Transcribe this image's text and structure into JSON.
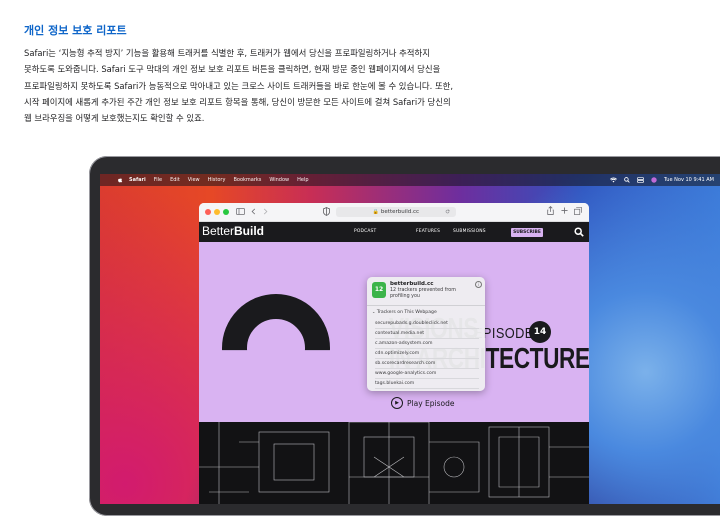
{
  "heading": "개인 정보 보호 리포트",
  "paragraph": [
    "Safari는 ‘지능형 추적 방지’ 기능을 활용해 트래커를 식별한 후, 트래커가 웹에서 당신을 프로파일링하거나 추적하지",
    "못하도록 도와줍니다. Safari 도구 막대의 개인 정보 보호 리포트 버튼을 클릭하면, 현재 방문 중인 웹페이지에서 당신을",
    "프로파일링하지 못하도록 Safari가 능동적으로 막아내고 있는 크로스 사이트 트래커들을 바로 한눈에 볼 수 있습니다. 또한,",
    "시작 페이지에 새롭게 추가된 주간 개인 정보 보호 리포트 항목을 통해, 당신이 방문한 모든 사이트에 걸쳐 Safari가 당신의",
    "웹 브라우징을 어떻게 보호했는지도 확인할 수 있죠."
  ],
  "menubar": {
    "items": [
      "Safari",
      "File",
      "Edit",
      "View",
      "History",
      "Bookmarks",
      "Window",
      "Help"
    ],
    "clock": "Tue Nov 10  9:41 AM"
  },
  "browser": {
    "address": "betterbuild.cc"
  },
  "site": {
    "logo_light": "Better",
    "logo_bold": "Build",
    "nav": [
      "PODCAST",
      "FEATURES",
      "SUBMISSIONS"
    ],
    "subscribe": "SUBSCRIBE",
    "title_line1": "VISIONS",
    "title_line2": "IN ARCHITECTURE",
    "episode_label": "EPISODE",
    "episode_number": "14",
    "play_label": "Play Episode"
  },
  "privacy_report": {
    "count": "12",
    "site": "betterbuild.cc",
    "summary": "12 trackers prevented from profiling you",
    "section": "Trackers on This Webpage",
    "trackers": [
      "securepubads.g.doubleclick.net",
      "contextual.media.net",
      "c.amazon-adsystem.com",
      "cdn.optimizely.com",
      "sb.scorecardresearch.com",
      "www.google-analytics.com",
      "tags.bluekai.com"
    ]
  },
  "colors": {
    "heading_blue": "#0f66c9",
    "site_purple": "#d9b3f2",
    "tracker_green": "#3cb44a"
  }
}
